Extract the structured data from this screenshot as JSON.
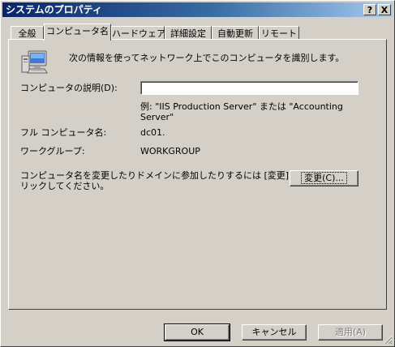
{
  "window": {
    "title": "システムのプロパティ",
    "help_label": "?",
    "close_label": "X"
  },
  "tabs": [
    {
      "label": "全般"
    },
    {
      "label": "コンピュータ名"
    },
    {
      "label": "ハードウェア"
    },
    {
      "label": "詳細設定"
    },
    {
      "label": "自動更新"
    },
    {
      "label": "リモート"
    }
  ],
  "content": {
    "intro": "次の情報を使ってネットワーク上でこのコンピュータを識別します。",
    "description_label": "コンピュータの説明(D):",
    "description_value": "",
    "example_line1": "例: \"IIS Production Server\" または \"Accounting",
    "example_line2": "Server\"",
    "full_name_label": "フル コンピュータ名:",
    "full_name_value": "dc01.",
    "workgroup_label": "ワークグループ:",
    "workgroup_value": "WORKGROUP",
    "change_text_line1": "コンピュータ名を変更したりドメインに参加したりするには [変更] をク",
    "change_text_line2": "リックしてください。",
    "change_button": "変更(C)..."
  },
  "footer": {
    "ok": "OK",
    "cancel": "キャンセル",
    "apply": "適用(A)"
  }
}
